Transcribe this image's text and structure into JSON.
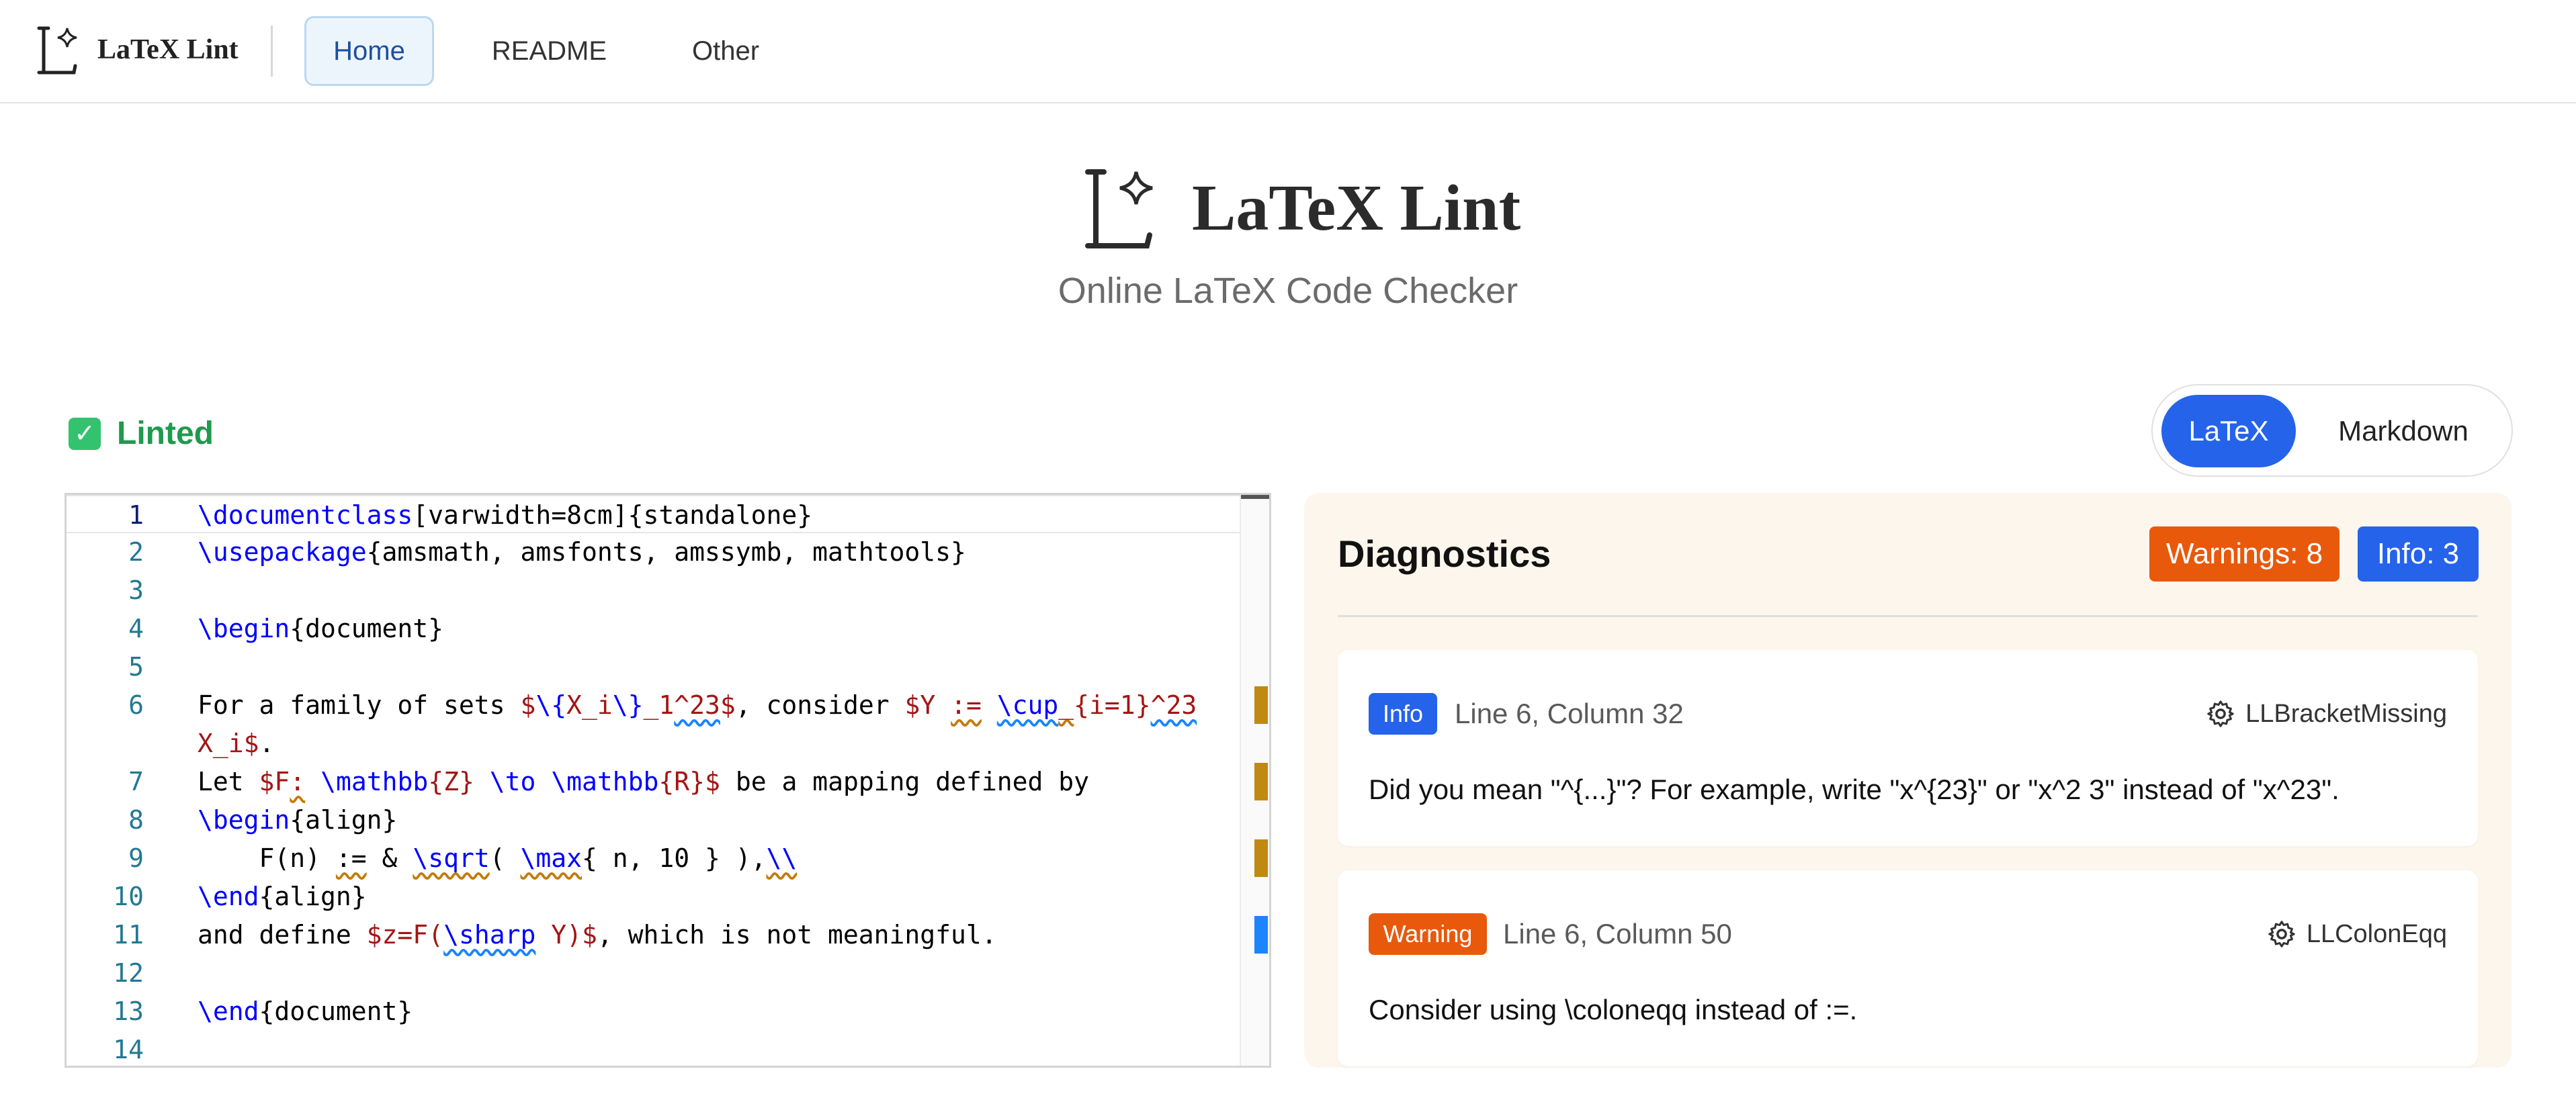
{
  "nav": {
    "brand": "LaTeX Lint",
    "tabs": [
      {
        "label": "Home",
        "active": true
      },
      {
        "label": "README",
        "active": false
      },
      {
        "label": "Other",
        "active": false
      }
    ]
  },
  "hero": {
    "title": "LaTeX Lint",
    "subtitle": "Online LaTeX Code Checker"
  },
  "status": {
    "label": "Linted",
    "icon": "check-icon",
    "color": "#1f9a4d"
  },
  "mode_toggle": {
    "options": [
      {
        "label": "LaTeX",
        "active": true
      },
      {
        "label": "Markdown",
        "active": false
      }
    ],
    "accent": "#2563eb"
  },
  "editor": {
    "current_line": 1,
    "line_numbers": [
      "1",
      "2",
      "3",
      "4",
      "5",
      "6",
      "",
      "7",
      "8",
      "9",
      "10",
      "11",
      "12",
      "13",
      "14"
    ],
    "lines": [
      "\\documentclass[varwidth=8cm]{standalone}",
      "\\usepackage{amsmath, amsfonts, amssymb, mathtools}",
      "",
      "\\begin{document}",
      "",
      "For a family of sets $\\{X_i\\}_1^23$, consider $Y := \\cup_{i=1}^23",
      "X_i$.",
      "Let $F: \\mathbb{Z} \\to \\mathbb{R}$ be a mapping defined by",
      "\\begin{align}",
      "    F(n) := & \\sqrt( \\max{ n, 10 } ),\\\\",
      "\\end{align}",
      "and define $z=F(\\sharp Y)$, which is not meaningful.",
      "",
      "\\end{document}",
      ""
    ],
    "ruler_colors": {
      "warning": "#c08a12",
      "info": "#1a85ff"
    }
  },
  "diagnostics": {
    "title": "Diagnostics",
    "warnings_badge": "Warnings: 8",
    "info_badge": "Info: 3",
    "warning_color": "#e8590c",
    "info_color": "#2563eb",
    "items": [
      {
        "severity": "Info",
        "location": "Line 6, Column 32",
        "rule": "LLBracketMissing",
        "message": "Did you mean \"^{...}\"? For example, write \"x^{23}\" or \"x^2 3\" instead of \"x^23\"."
      },
      {
        "severity": "Warning",
        "location": "Line 6, Column 50",
        "rule": "LLColonEqq",
        "message": "Consider using \\coloneqq instead of :=."
      }
    ]
  }
}
